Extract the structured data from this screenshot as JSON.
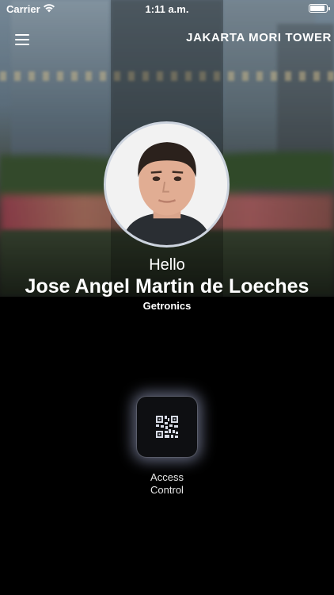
{
  "status_bar": {
    "carrier": "Carrier",
    "time": "1:11 a.m.",
    "battery_level": 0.9
  },
  "header": {
    "title": "JAKARTA MORI TOWER",
    "menu_icon": "hamburger-menu-icon"
  },
  "profile": {
    "greeting": "Hello",
    "name": "Jose Angel Martin de Loeches",
    "company": "Getronics"
  },
  "actions": [
    {
      "label_line1": "Access",
      "label_line2": "Control",
      "icon": "qr-code-icon"
    }
  ]
}
